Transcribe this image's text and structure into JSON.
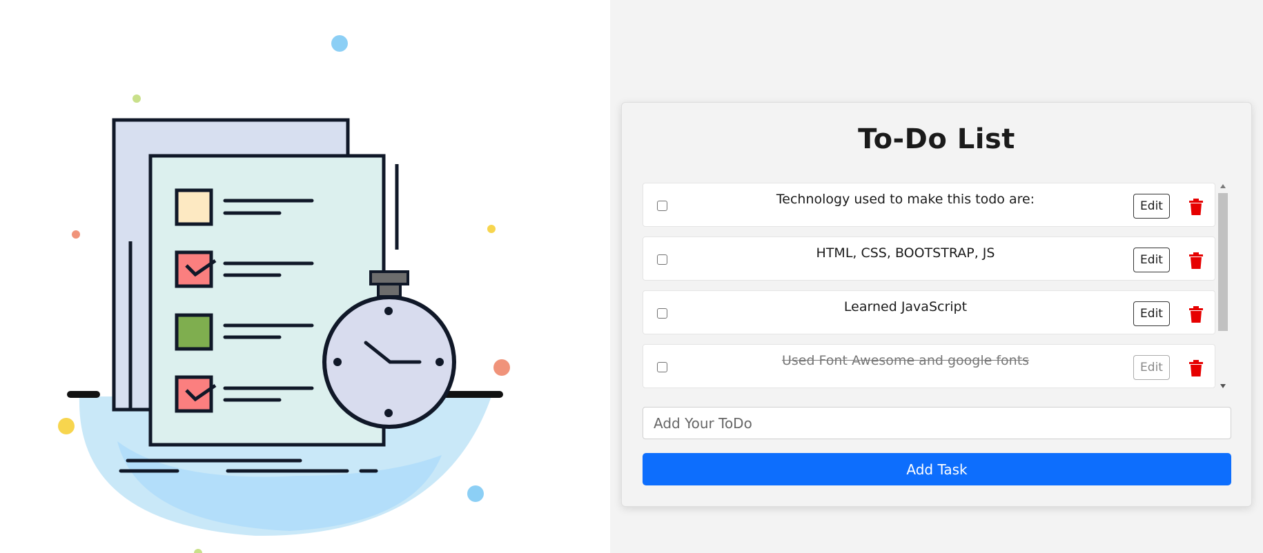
{
  "app": {
    "title": "To-Do List"
  },
  "todos": [
    {
      "text": "Technology used to make this todo are:",
      "done": false,
      "edit_label": "Edit"
    },
    {
      "text": "HTML, CSS, BOOTSTRAP, JS",
      "done": false,
      "edit_label": "Edit"
    },
    {
      "text": "Learned JavaScript",
      "done": false,
      "edit_label": "Edit"
    },
    {
      "text": "Used Font Awesome and google fonts",
      "done": true,
      "edit_label": "Edit"
    }
  ],
  "input": {
    "placeholder": "Add Your ToDo",
    "value": ""
  },
  "add_button": {
    "label": "Add Task"
  },
  "colors": {
    "accent": "#0d6efd",
    "delete": "#e60000",
    "background": "#f3f3f3"
  },
  "icons": {
    "delete": "trash-icon",
    "illustration": "checklist-stopwatch-illustration"
  }
}
